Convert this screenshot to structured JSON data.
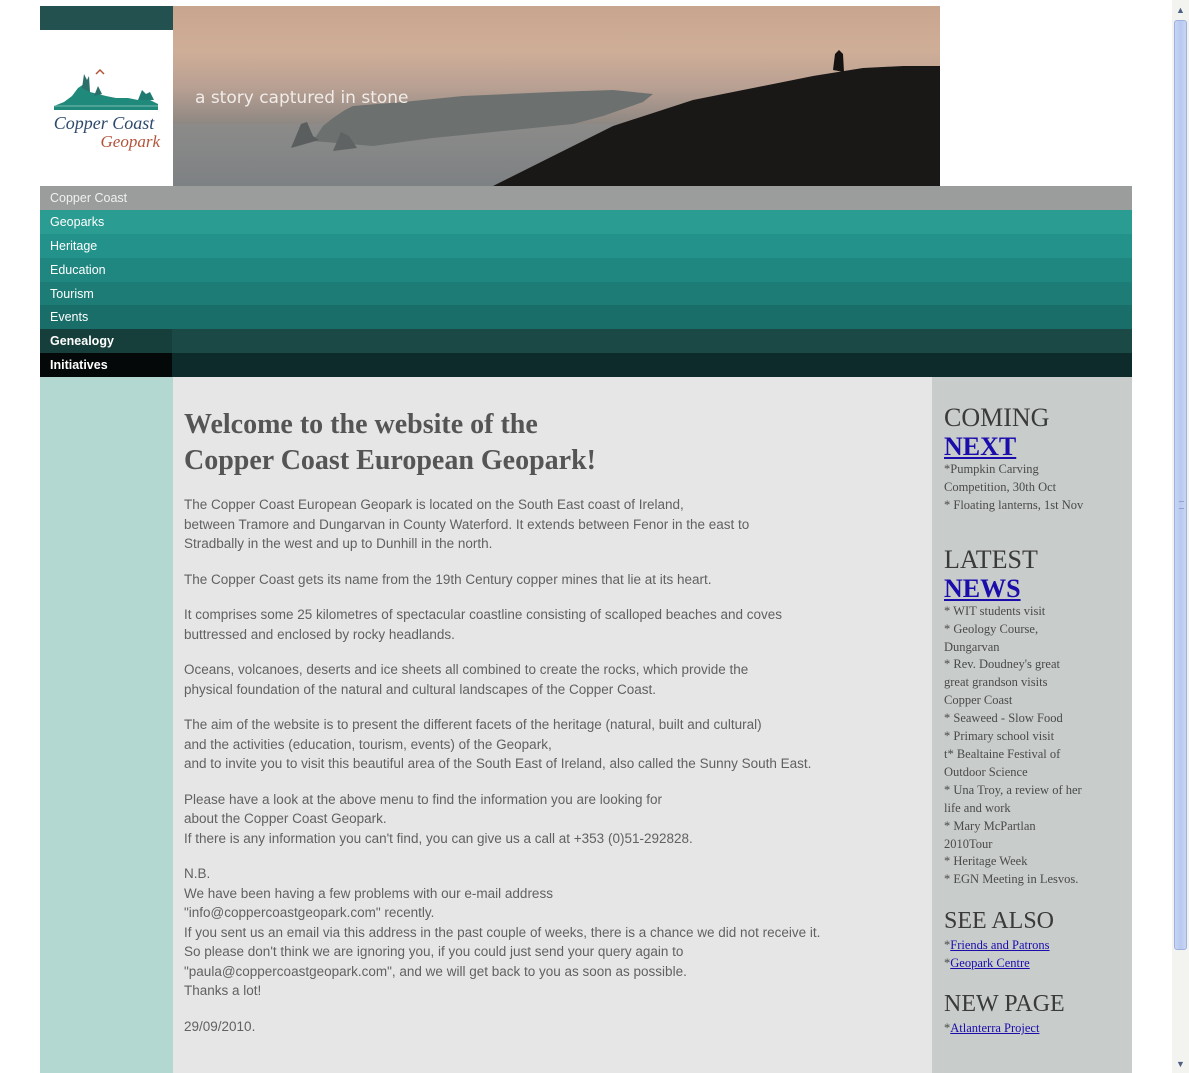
{
  "logo": {
    "title": "Copper Coast",
    "subtitle": "Geopark"
  },
  "banner": {
    "tagline": "a story captured in stone"
  },
  "nav": {
    "items": [
      "Copper Coast",
      "Geoparks",
      "Heritage",
      "Education",
      "Tourism",
      "Events",
      "Genealogy",
      "Initiatives"
    ],
    "colors": [
      "#9b9d9d",
      "#2a9c92",
      "#22928a",
      "#1f8680",
      "#1d7c76",
      "#1a6e69",
      "#163f3c",
      "#0c2b2a"
    ]
  },
  "main": {
    "headline_line1": "Welcome to the website of the",
    "headline_line2": "Copper Coast European Geopark!",
    "p1": [
      "The Copper Coast European Geopark is located on the South East coast of Ireland,",
      "between Tramore and Dungarvan in County Waterford. It extends between Fenor in the east to",
      "Stradbally in the west and up to Dunhill in the north."
    ],
    "p2": [
      "The Copper Coast gets its name from the 19th Century copper mines that lie at its heart."
    ],
    "p3": [
      "It comprises some 25 kilometres of spectacular coastline consisting of scalloped beaches and coves",
      "buttressed and enclosed by rocky headlands."
    ],
    "p4": [
      "Oceans, volcanoes, deserts and ice sheets all combined to create the rocks, which provide the",
      "physical foundation of the natural and cultural landscapes of the Copper Coast."
    ],
    "p5": [
      "The aim of the website is to present the different facets of the heritage (natural, built and cultural)",
      "and the activities (education, tourism, events) of the Geopark,",
      "and to invite you to visit this beautiful area of the South East of Ireland, also called the Sunny South East."
    ],
    "p6": [
      "Please have a look at the above menu to find the information you are looking for",
      "about the Copper Coast Geopark.",
      "If there is any information you can't find, you can give us a call at +353 (0)51-292828."
    ],
    "p7": [
      "N.B.",
      "We have been having a few problems with our e-mail address",
      "\"info@coppercoastgeopark.com\" recently.",
      "If you sent us an email via this address in the past couple of weeks, there is a chance we did not receive it.",
      "So please don't think we are ignoring you, if you could just send your query again to",
      "\"paula@coppercoastgeopark.com\", and we will get back to you as soon as possible.",
      "Thanks a lot!"
    ],
    "date": "29/09/2010."
  },
  "sidebar": {
    "coming": "COMING",
    "next": "NEXT",
    "coming_items": [
      "*Pumpkin Carving",
      "Competition, 30th Oct",
      "* Floating lanterns, 1st Nov"
    ],
    "latest": "LATEST",
    "news": "NEWS",
    "news_items": [
      "* WIT students visit",
      "* Geology Course,",
      "Dungarvan",
      "* Rev. Doudney's great",
      "great grandson visits",
      "Copper Coast",
      "* Seaweed - Slow Food",
      "* Primary school visit",
      "t* Bealtaine Festival of",
      "Outdoor Science",
      "* Una Troy, a review of her",
      "life and work",
      "* Mary McPartlan",
      "2010Tour",
      "* Heritage Week",
      "* EGN Meeting in Lesvos."
    ],
    "see_also": "SEE ALSO",
    "see_also_links": [
      "Friends and Patrons",
      "Geopark Centre"
    ],
    "new_page": "NEW PAGE",
    "new_page_link": "Atlanterra Project",
    "link_prefix": "*"
  },
  "scrollbar": {
    "up_icon": "scroll-up-arrow",
    "down_icon": "scroll-down-arrow"
  }
}
